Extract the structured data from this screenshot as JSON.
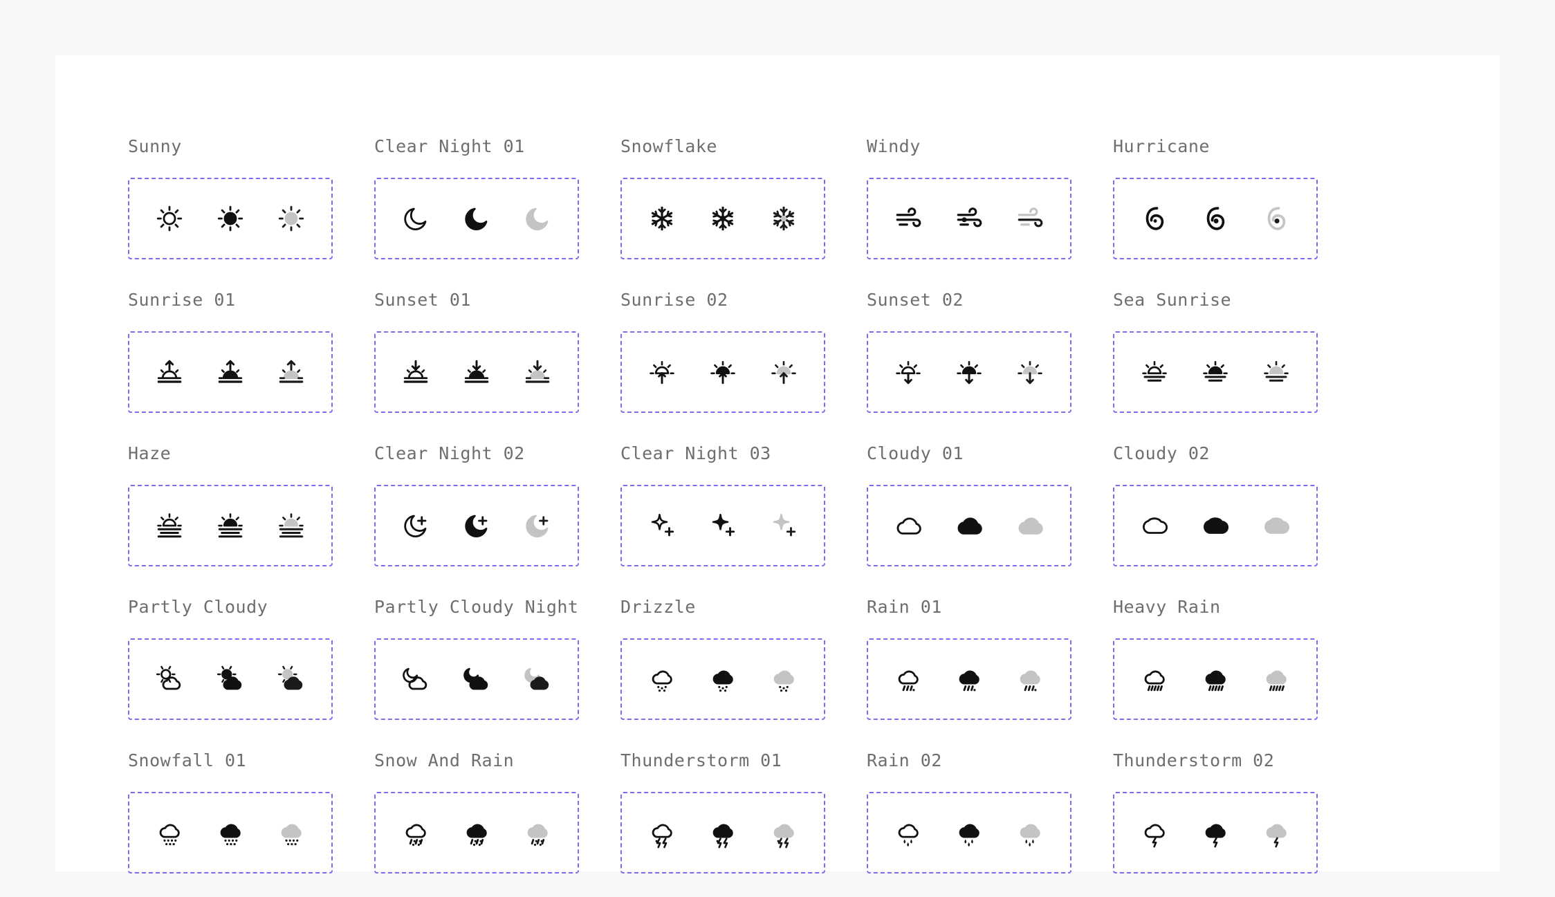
{
  "icons": [
    {
      "name": "Sunny",
      "glyph": "sun"
    },
    {
      "name": "Clear Night 01",
      "glyph": "moon"
    },
    {
      "name": "Snowflake",
      "glyph": "snowflake"
    },
    {
      "name": "Windy",
      "glyph": "wind"
    },
    {
      "name": "Hurricane",
      "glyph": "hurricane"
    },
    {
      "name": "Sunrise 01",
      "glyph": "sunrise1"
    },
    {
      "name": "Sunset 01",
      "glyph": "sunset1"
    },
    {
      "name": "Sunrise 02",
      "glyph": "sunrise2"
    },
    {
      "name": "Sunset 02",
      "glyph": "sunset2"
    },
    {
      "name": "Sea Sunrise",
      "glyph": "seasunrise"
    },
    {
      "name": "Haze",
      "glyph": "haze"
    },
    {
      "name": "Clear Night 02",
      "glyph": "moonstar"
    },
    {
      "name": "Clear Night 03",
      "glyph": "sparkles"
    },
    {
      "name": "Cloudy 01",
      "glyph": "cloud1"
    },
    {
      "name": "Cloudy 02",
      "glyph": "cloud2"
    },
    {
      "name": "Partly Cloudy",
      "glyph": "partlycloudy"
    },
    {
      "name": "Partly Cloudy Night",
      "glyph": "partlycloudynight"
    },
    {
      "name": "Drizzle",
      "glyph": "drizzle"
    },
    {
      "name": "Rain 01",
      "glyph": "rain1"
    },
    {
      "name": "Heavy Rain",
      "glyph": "heavyrain"
    },
    {
      "name": "Snowfall 01",
      "glyph": "snowfall"
    },
    {
      "name": "Snow And Rain",
      "glyph": "snowrain"
    },
    {
      "name": "Thunderstorm 01",
      "glyph": "thunder1"
    },
    {
      "name": "Rain 02",
      "glyph": "rain2"
    },
    {
      "name": "Thunderstorm 02",
      "glyph": "thunder2"
    }
  ],
  "variants": [
    "outline",
    "solid",
    "duotone"
  ],
  "colors": {
    "stroke": "#111111",
    "fill": "#111111",
    "duo_light": "#c4c4c4",
    "duo_dark": "#1a1a1a",
    "box_border": "#7b6bf0",
    "label": "#6e6e6e"
  }
}
